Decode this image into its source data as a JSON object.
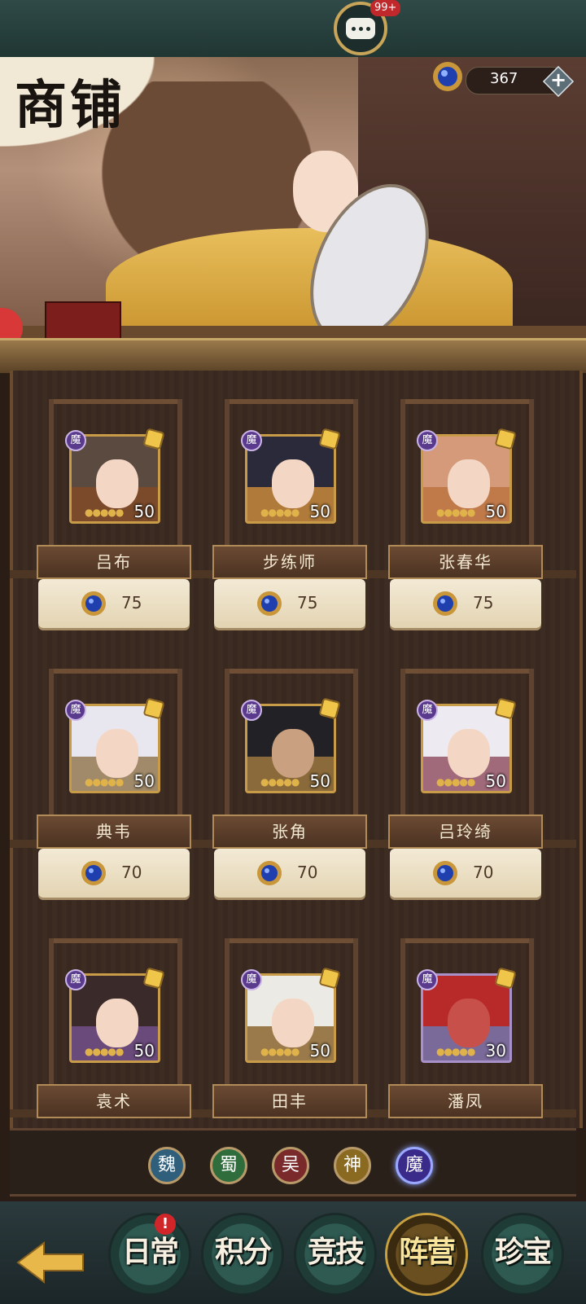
{
  "top_bar": {
    "chat_badge": "99+"
  },
  "banner": {
    "title": "商铺",
    "currency_value": "367",
    "currency_add": "+"
  },
  "shop": {
    "items": [
      {
        "name": "吕布",
        "faction": "魔",
        "level": "50",
        "price": "75"
      },
      {
        "name": "步练师",
        "faction": "魔",
        "level": "50",
        "price": "75"
      },
      {
        "name": "张春华",
        "faction": "魔",
        "level": "50",
        "price": "75"
      },
      {
        "name": "典韦",
        "faction": "魔",
        "level": "50",
        "price": "70"
      },
      {
        "name": "张角",
        "faction": "魔",
        "level": "50",
        "price": "70"
      },
      {
        "name": "吕玲绮",
        "faction": "魔",
        "level": "50",
        "price": "70"
      },
      {
        "name": "袁术",
        "faction": "魔",
        "level": "50"
      },
      {
        "name": "田丰",
        "faction": "魔",
        "level": "50"
      },
      {
        "name": "潘凤",
        "faction": "魔",
        "level": "30"
      }
    ],
    "filters": [
      {
        "label": "魏",
        "color": "#2f5f7a"
      },
      {
        "label": "蜀",
        "color": "#2f6e3c"
      },
      {
        "label": "吴",
        "color": "#7a2a2a"
      },
      {
        "label": "神",
        "color": "#8a6a20"
      },
      {
        "label": "魔",
        "color": "#3a2a8a",
        "selected": true
      }
    ]
  },
  "bottom_nav": {
    "badge": "!",
    "tabs": [
      {
        "label": "日常"
      },
      {
        "label": "积分"
      },
      {
        "label": "竞技"
      },
      {
        "label": "阵营",
        "selected": true
      },
      {
        "label": "珍宝"
      }
    ]
  }
}
